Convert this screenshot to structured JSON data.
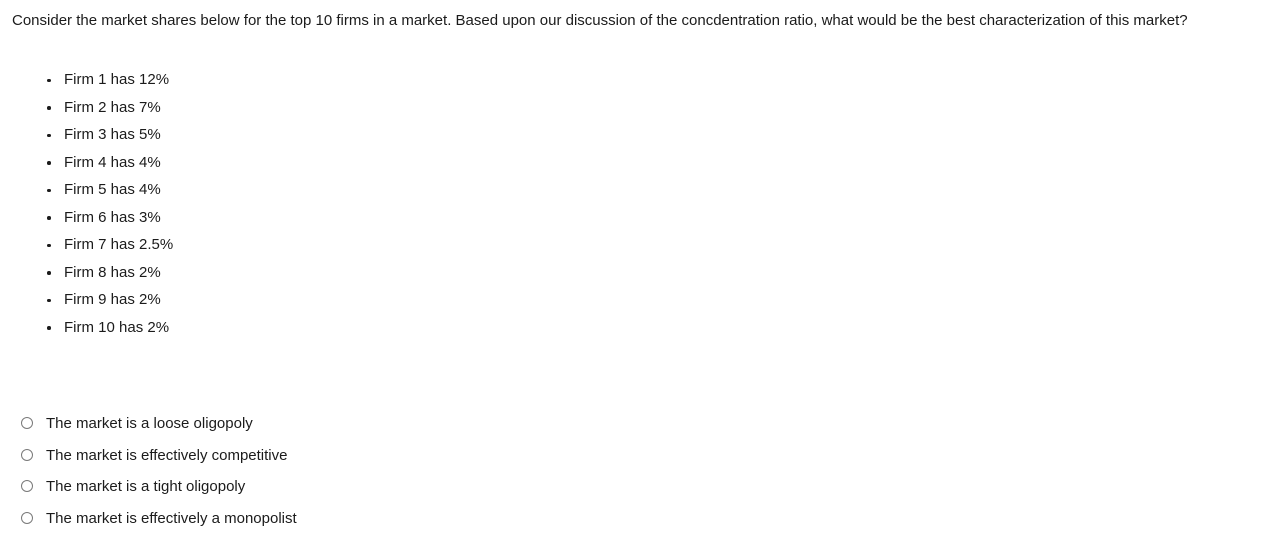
{
  "question": {
    "prompt": "Consider the market shares below for the top 10 firms in a market. Based upon our discussion of the concdentration ratio, what would be the best characterization of this market?"
  },
  "firm_shares": {
    "items": [
      {
        "label": "Firm 1 has 12%",
        "firm": "Firm 1",
        "share": "12%"
      },
      {
        "label": "Firm 2 has 7%",
        "firm": "Firm 2",
        "share": "7%"
      },
      {
        "label": "Firm 3 has 5%",
        "firm": "Firm 3",
        "share": "5%"
      },
      {
        "label": "Firm 4 has 4%",
        "firm": "Firm 4",
        "share": "4%"
      },
      {
        "label": "Firm 5 has 4%",
        "firm": "Firm 5",
        "share": "4%"
      },
      {
        "label": "Firm 6 has 3%",
        "firm": "Firm 6",
        "share": "3%"
      },
      {
        "label": "Firm 7 has 2.5%",
        "firm": "Firm 7",
        "share": "2.5%"
      },
      {
        "label": "Firm 8 has 2%",
        "firm": "Firm 8",
        "share": "2%"
      },
      {
        "label": "Firm 9 has 2%",
        "firm": "Firm 9",
        "share": "2%"
      },
      {
        "label": "Firm 10 has 2%",
        "firm": "Firm 10",
        "share": "2%"
      }
    ]
  },
  "answers": {
    "selected_index": -1,
    "options": [
      {
        "label": "The market is a loose oligopoly",
        "selected": false
      },
      {
        "label": "The market is effectively competitive",
        "selected": false
      },
      {
        "label": "The market is a tight oligopoly",
        "selected": false
      },
      {
        "label": "The market is effectively a monopolist",
        "selected": false
      }
    ]
  },
  "colors": {
    "background": "#ffffff",
    "text": "#1b1b1b",
    "radio_border": "#7a7a7a"
  }
}
